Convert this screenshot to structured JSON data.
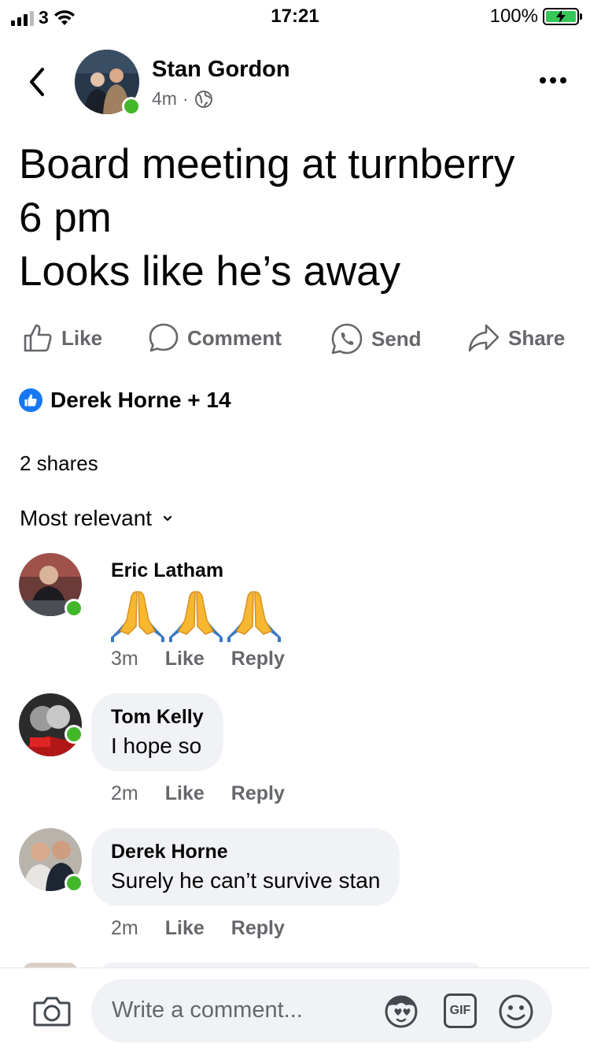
{
  "status_bar": {
    "carrier": "3",
    "time": "17:21",
    "battery": "100%"
  },
  "header": {
    "name": "Stan Gordon",
    "time_ago": "4m",
    "dot": "·",
    "icons": [
      "back-chevron-icon",
      "globe-icon",
      "more-icon"
    ]
  },
  "post": {
    "lines": [
      "Board meeting at turnberry",
      "6 pm",
      "Looks like he’s away"
    ]
  },
  "actions": {
    "like": "Like",
    "comment": "Comment",
    "send": "Send",
    "share": "Share"
  },
  "reactions": {
    "text": "Derek Horne + 14"
  },
  "shares": "2 shares",
  "sort": {
    "label": "Most relevant"
  },
  "comments": [
    {
      "name": "Eric Latham",
      "content": "🙏🙏🙏",
      "time": "3m",
      "like": "Like",
      "reply": "Reply"
    },
    {
      "name": "Tom Kelly",
      "content": "I hope so",
      "time": "2m",
      "like": "Like",
      "reply": "Reply"
    },
    {
      "name": "Derek Horne",
      "content": "Surely he can’t survive stan",
      "time": "2m",
      "like": "Like",
      "reply": "Reply"
    }
  ],
  "composer": {
    "placeholder": "Write a comment...",
    "gif_label": "GIF",
    "icons": [
      "camera-icon",
      "avatar-sticker-icon",
      "gif-icon",
      "emoji-icon"
    ]
  },
  "colors": {
    "accent": "#1877f2",
    "online": "#42b72a",
    "secondary_text": "#65676b",
    "bubble": "#f0f2f5",
    "battery": "#34c759"
  }
}
